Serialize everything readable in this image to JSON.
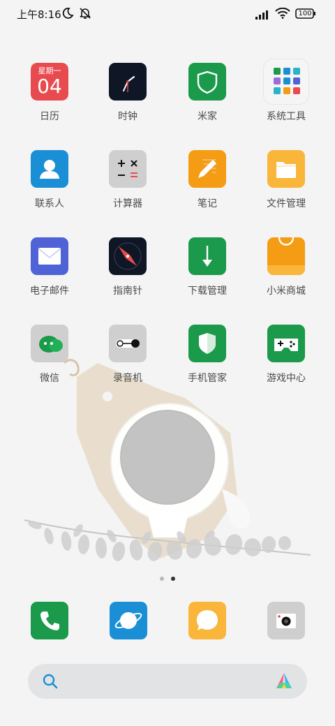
{
  "status_bar": {
    "time": "上午8:16",
    "battery": "100"
  },
  "calendar_tile": {
    "weekday": "星期一",
    "day": "04"
  },
  "apps": [
    {
      "label": "日历",
      "icon": "calendar-icon"
    },
    {
      "label": "时钟",
      "icon": "clock-icon"
    },
    {
      "label": "米家",
      "icon": "shield-icon"
    },
    {
      "label": "系统工具",
      "icon": "folder-grid-icon"
    },
    {
      "label": "联系人",
      "icon": "contact-icon"
    },
    {
      "label": "计算器",
      "icon": "calculator-icon"
    },
    {
      "label": "笔记",
      "icon": "notes-icon"
    },
    {
      "label": "文件管理",
      "icon": "file-manager-icon"
    },
    {
      "label": "电子邮件",
      "icon": "email-icon"
    },
    {
      "label": "指南针",
      "icon": "compass-icon"
    },
    {
      "label": "下载管理",
      "icon": "download-icon"
    },
    {
      "label": "小米商城",
      "icon": "shopping-bag-icon"
    },
    {
      "label": "微信",
      "icon": "wechat-icon"
    },
    {
      "label": "录音机",
      "icon": "recorder-icon"
    },
    {
      "label": "手机管家",
      "icon": "security-icon"
    },
    {
      "label": "游戏中心",
      "icon": "gamepad-icon"
    }
  ],
  "dock": [
    {
      "icon": "phone-icon"
    },
    {
      "icon": "browser-icon"
    },
    {
      "icon": "messages-icon"
    },
    {
      "icon": "camera-icon"
    }
  ],
  "pages": {
    "count": 2,
    "current": 2
  },
  "colors": {
    "calendar": "#e84b4f",
    "dark": "#0f1626",
    "green": "#1a9a4a",
    "blue": "#1a8fd6",
    "gray": "#cfcfcf",
    "orange": "#f49c14",
    "yellow": "#fab53b",
    "indigo": "#4f63d6"
  }
}
